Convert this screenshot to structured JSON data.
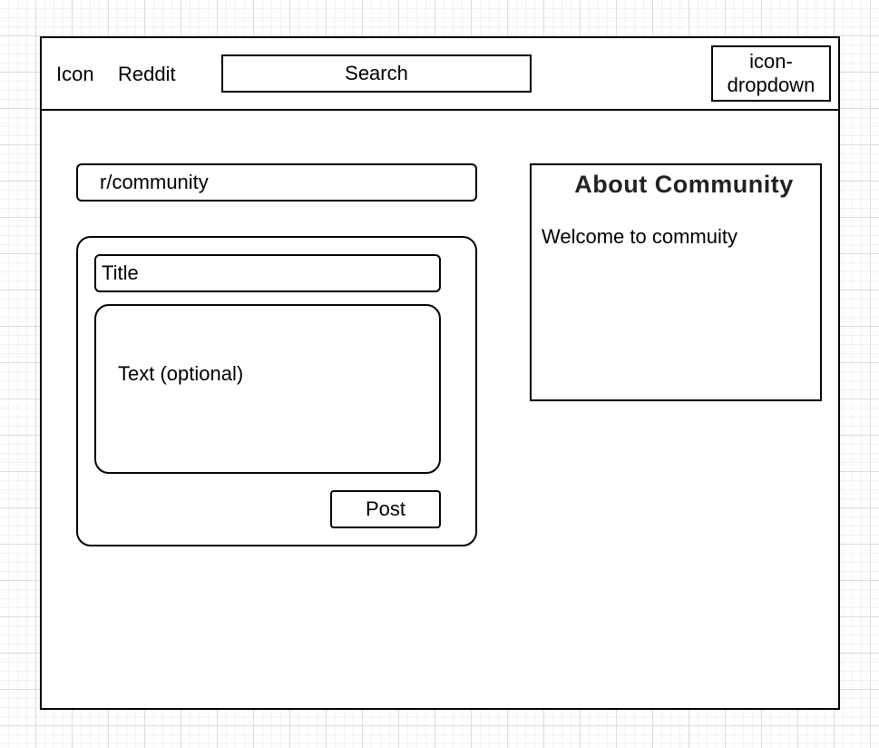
{
  "header": {
    "icon_label": "Icon",
    "brand": "Reddit",
    "search_label": "Search",
    "dropdown_line1": "icon-",
    "dropdown_line2": "dropdown"
  },
  "community": {
    "name": "r/community"
  },
  "post_form": {
    "title_placeholder": "Title",
    "text_placeholder": "Text (optional)",
    "post_label": "Post"
  },
  "about": {
    "title": "About Community",
    "description": "Welcome to commuity"
  }
}
